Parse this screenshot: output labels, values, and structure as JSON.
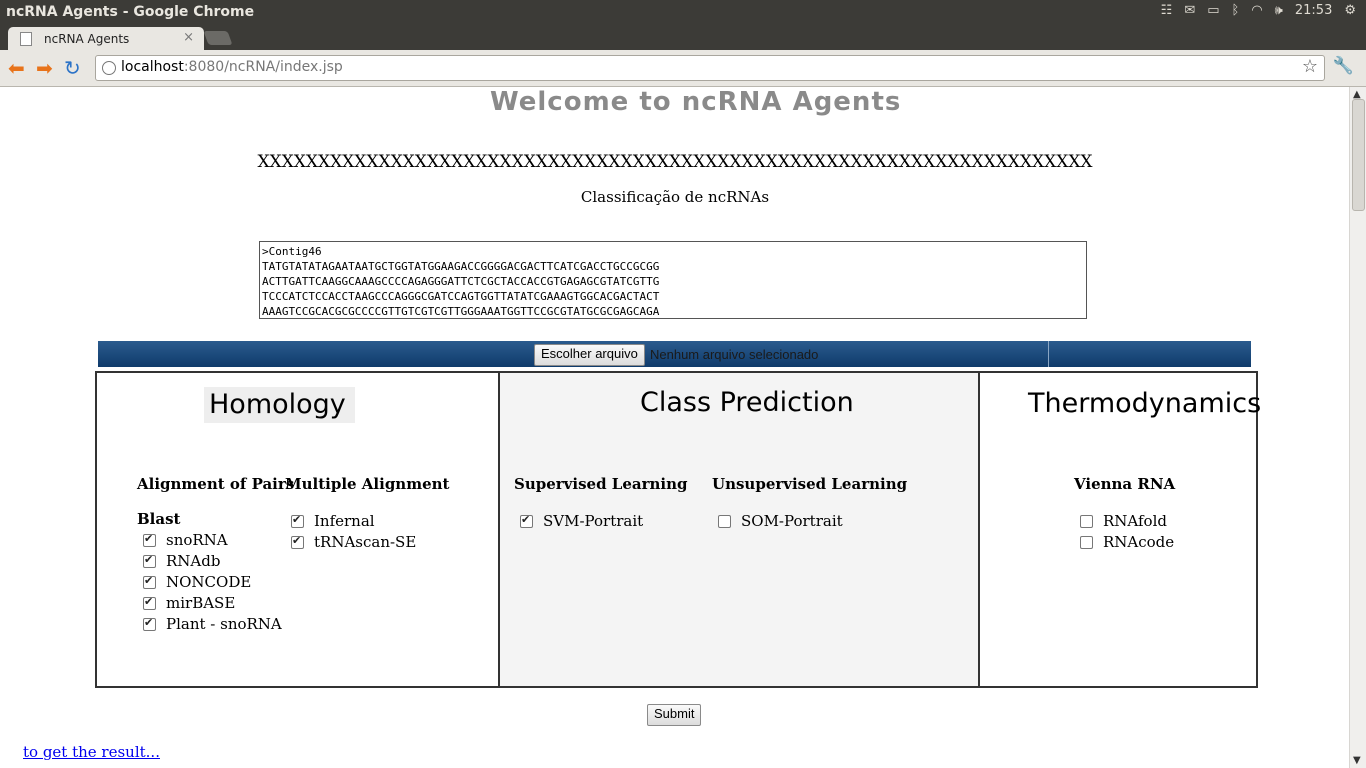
{
  "window": {
    "title": "ncRNA Agents - Google Chrome"
  },
  "tray": {
    "time": "21:53"
  },
  "browser": {
    "tab_title": "ncRNA Agents",
    "tab_close": "×",
    "url_host": "localhost",
    "url_rest": ":8080/ncRNA/index.jsp"
  },
  "page": {
    "banner": "Welcome to ncRNA Agents",
    "xline": "XXXXXXXXXXXXXXXXXXXXXXXXXXXXXXXXXXXXXXXXXXXXXXXXXXXXXXXXXXXXXXXXXXXXX",
    "subtitle": "Classificação de ncRNAs",
    "sequence": ">Contig46\nTATGTATATAGAATAATGCTGGTATGGAAGACCGGGGACGACTTCATCGACCTGCCGCGG\nACTTGATTCAAGGCAAAGCCCCAGAGGGATTCTCGCTACCACCGTGAGAGCGTATCGTTG\nTCCCATCTCCACCTAAGCCCAGGGCGATCCAGTGGTTATATCGAAAGTGGCACGACTACT\nAAAGTCCGCACGCGCCCCGTTGTCGTCGTTGGGAAATGGTTCCGCGTATGCGCGAGCAGA",
    "file_button": "Escolher arquivo",
    "file_status": "Nenhum arquivo selecionado",
    "homology": {
      "title": "Homology",
      "pairs_header": "Alignment of Pairs",
      "blast_header": "Blast",
      "blast_items": [
        {
          "label": "snoRNA",
          "checked": true
        },
        {
          "label": "RNAdb",
          "checked": true
        },
        {
          "label": "NONCODE",
          "checked": true
        },
        {
          "label": "mirBASE",
          "checked": true
        },
        {
          "label": "Plant - snoRNA",
          "checked": true
        }
      ],
      "multi_header": "Multiple Alignment",
      "multi_items": [
        {
          "label": "Infernal",
          "checked": true
        },
        {
          "label": "tRNAscan-SE",
          "checked": true
        }
      ]
    },
    "class_prediction": {
      "title": "Class Prediction",
      "supervised_header": "Supervised Learning",
      "supervised_items": [
        {
          "label": "SVM-Portrait",
          "checked": true
        }
      ],
      "unsupervised_header": "Unsupervised Learning",
      "unsupervised_items": [
        {
          "label": "SOM-Portrait",
          "checked": false
        }
      ]
    },
    "thermodynamics": {
      "title": "Thermodynamics",
      "vienna_header": "Vienna RNA",
      "items": [
        {
          "label": "RNAfold",
          "checked": false
        },
        {
          "label": "RNAcode",
          "checked": false
        }
      ]
    },
    "submit": "Submit",
    "result_link": "to get the result..."
  }
}
